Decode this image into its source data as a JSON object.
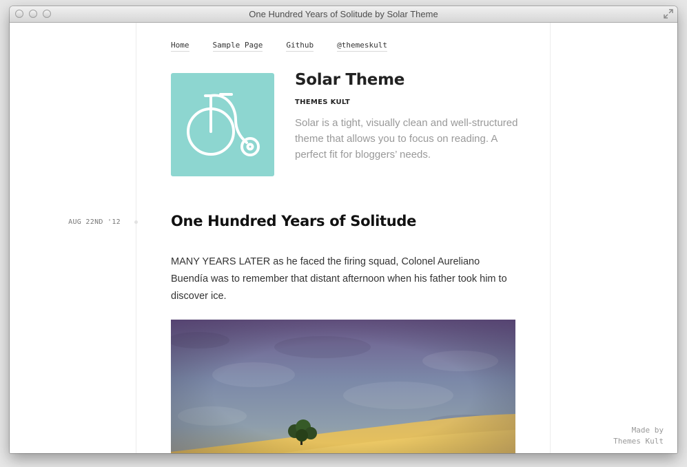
{
  "window": {
    "title": "One Hundred Years of Solitude by Solar Theme"
  },
  "nav": {
    "items": [
      "Home",
      "Sample Page",
      "Github",
      "@themeskult"
    ]
  },
  "site": {
    "title": "Solar Theme",
    "subtitle": "THEMES KULT",
    "description": "Solar is a tight, visually clean and well-structured theme that allows you to focus on reading. A perfect fit for bloggers’ needs.",
    "logo_icon": "penny-farthing-bicycle-icon",
    "logo_color": "#8dd6d0"
  },
  "post": {
    "date": "AUG 22ND '12",
    "title": "One Hundred Years of Solitude",
    "body": "MANY YEARS LATER as he faced the firing squad, Colonel Aureliano Buendía was to remember that distant afternoon when his father took him to discover ice.",
    "image": "landscape-tree-photo"
  },
  "footer": {
    "line1": "Made by",
    "line2": "Themes Kult"
  }
}
